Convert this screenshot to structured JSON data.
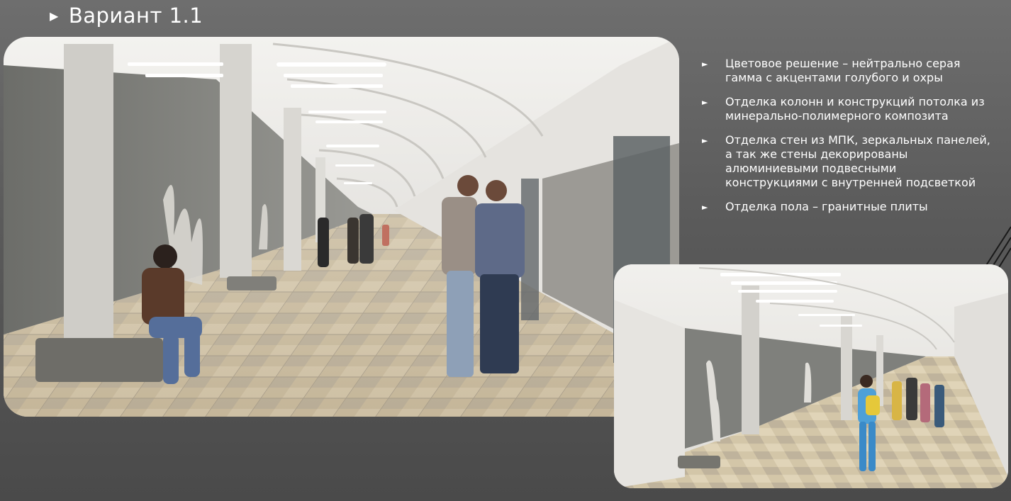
{
  "slide": {
    "title": "Вариант 1.1",
    "bullets": [
      {
        "text": "Цветовое решение – нейтрально серая\nгамма с акцентами голубого и охры"
      },
      {
        "text": "Отделка колонн и конструкций потолка из\nминерально-полимерного композита"
      },
      {
        "text": "Отделка стен из МПК, зеркальных панелей,\nа так же стены декорированы\nалюминиевыми подвесными\nконструкциями с внутренней подсветкой"
      },
      {
        "text": "Отделка пола – гранитные плиты"
      }
    ]
  },
  "colors": {
    "background": "#5a5a5a",
    "text": "#ffffff",
    "ceiling": "#ecebe8",
    "wall": "#7a7a76",
    "floor_stone": "#c9b79a"
  },
  "icons": {
    "bullet": "triangle-right"
  }
}
